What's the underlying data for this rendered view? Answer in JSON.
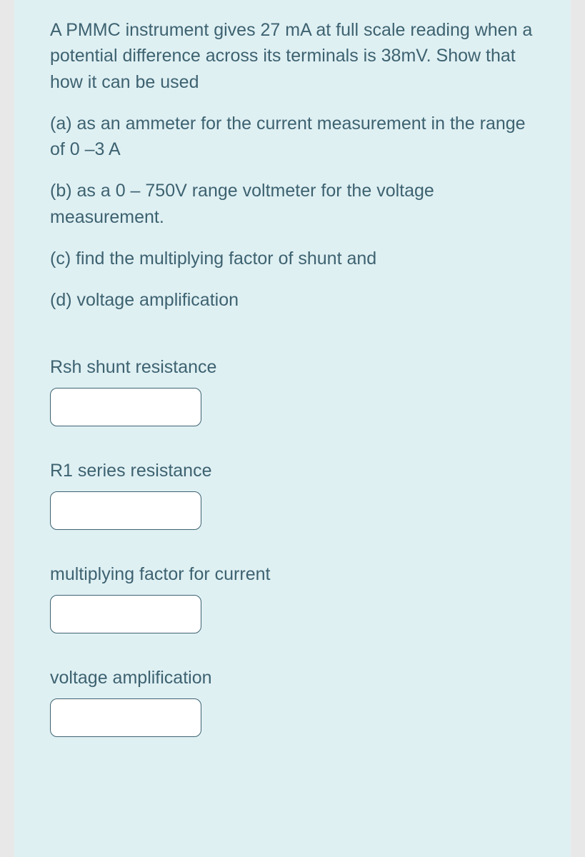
{
  "question": {
    "intro": " A PMMC instrument gives 27 mA at full scale reading when a potential difference across its terminals is 38mV. Show that how it can be used",
    "parts": [
      "(a) as an ammeter for the current measurement in the range of 0 –3 A",
      "(b) as a 0 – 750V range voltmeter for the voltage measurement.",
      "(c) find the multiplying factor of shunt and",
      "(d)  voltage amplification"
    ]
  },
  "answers": [
    {
      "label": "Rsh shunt resistance",
      "value": ""
    },
    {
      "label": "R1 series resistance",
      "value": ""
    },
    {
      "label": "multiplying factor for current",
      "value": ""
    },
    {
      "label": "voltage  amplification",
      "value": ""
    }
  ]
}
